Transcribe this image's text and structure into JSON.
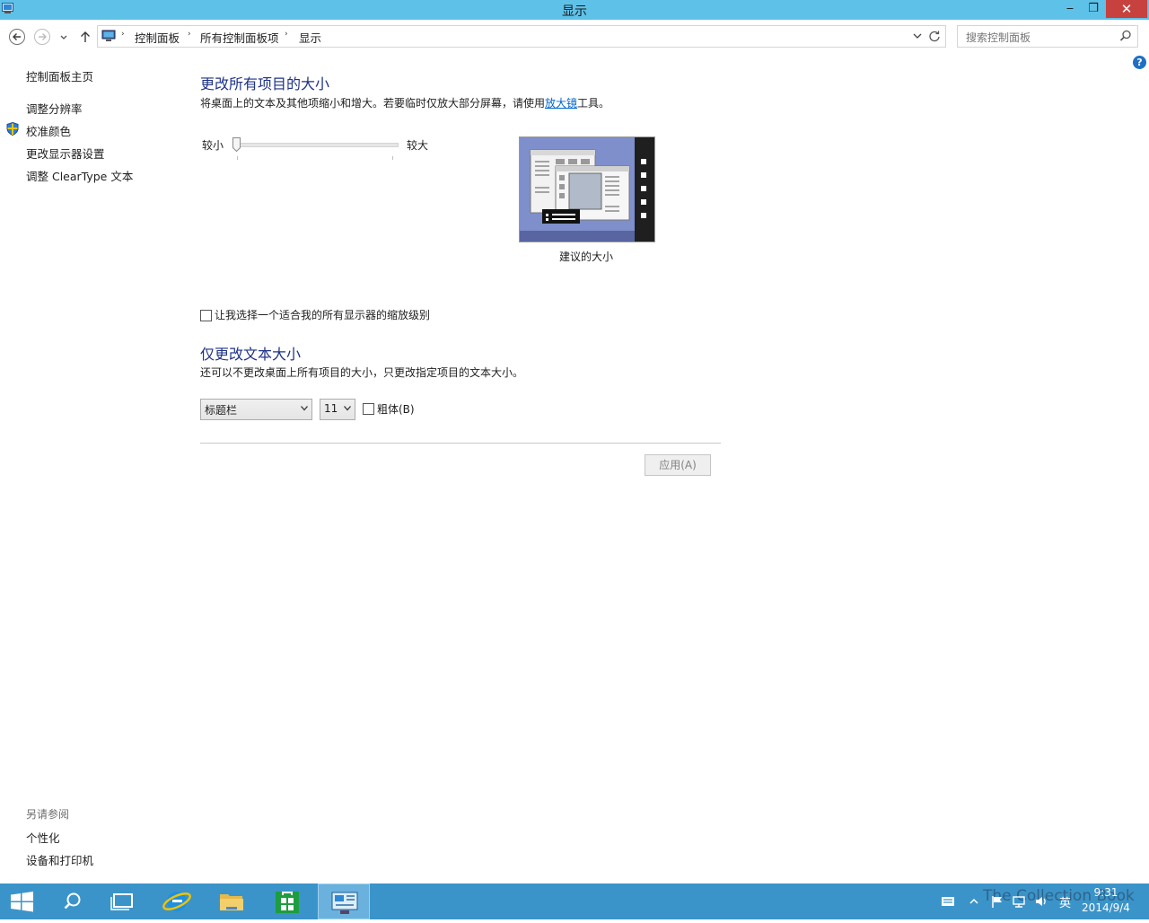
{
  "window": {
    "title": "显示",
    "min_symbol": "‒",
    "max_symbol": "❐",
    "close_symbol": "✕"
  },
  "address": {
    "breadcrumbs": [
      "控制面板",
      "所有控制面板项",
      "显示"
    ],
    "separator": "›"
  },
  "search": {
    "placeholder": "搜索控制面板"
  },
  "help": {
    "symbol": "?"
  },
  "sidebar": {
    "home": "控制面板主页",
    "items": [
      {
        "label": "调整分辨率"
      },
      {
        "label": "校准颜色"
      },
      {
        "label": "更改显示器设置"
      },
      {
        "label": "调整 ClearType 文本"
      }
    ],
    "see_also_title": "另请参阅",
    "see_also": [
      {
        "label": "个性化"
      },
      {
        "label": "设备和打印机"
      }
    ]
  },
  "main": {
    "size_heading": "更改所有项目的大小",
    "size_desc_before": "将桌面上的文本及其他项缩小和增大。若要临时仅放大部分屏幕，请使用",
    "size_desc_link": "放大镜",
    "size_desc_after": "工具。",
    "slider": {
      "small_label": "较小",
      "large_label": "较大",
      "level": 0
    },
    "preview_caption": "建议的大小",
    "custom_scale_checkbox": "让我选择一个适合我的所有显示器的缩放级别",
    "text_heading": "仅更改文本大小",
    "text_desc": "还可以不更改桌面上所有项目的大小，只更改指定项目的文本大小。",
    "item_select_value": "标题栏",
    "size_select_value": "11",
    "bold_label": "粗体(B)",
    "apply_label": "应用(A)"
  },
  "taskbar": {
    "ime": "英",
    "time": "9:31",
    "date": "2014/9/4",
    "watermark": "The Collection Book",
    "colors": {
      "bar": "#3b94c9",
      "active": "#6ab2dd"
    }
  }
}
